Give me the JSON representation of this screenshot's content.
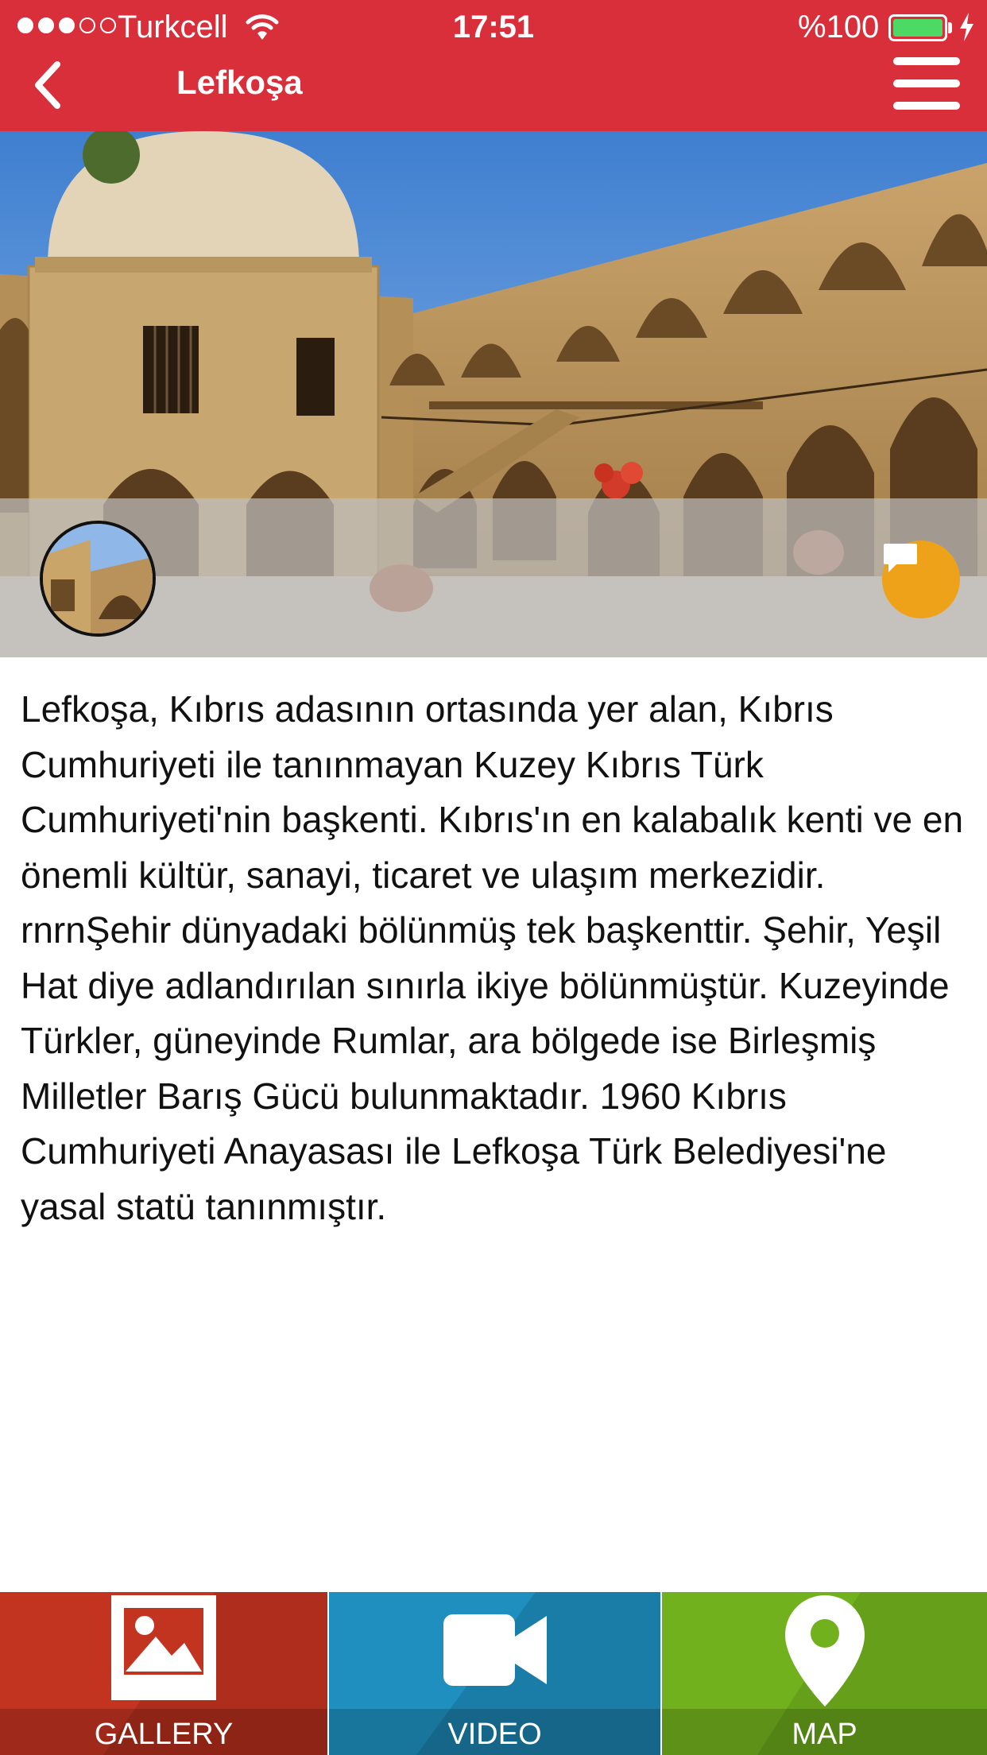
{
  "status_bar": {
    "carrier": "Turkcell",
    "time": "17:51",
    "battery_percent": "%100",
    "signal_bars_filled": 3,
    "signal_bars_total": 5
  },
  "nav": {
    "title": "Lefkoşa",
    "back_icon": "chevron-left-icon",
    "menu_icon": "hamburger-menu-icon"
  },
  "hero": {
    "comment_icon": "chat-bubble-icon"
  },
  "article": {
    "text": "Lefkoşa, Kıbrıs adasının ortasında yer alan, Kıbrıs Cumhuriyeti ile tanınmayan Kuzey Kıbrıs Türk Cumhuriyeti'nin başkenti. Kıbrıs'ın en kalabalık kenti ve en önemli kültür, sanayi, ticaret ve ulaşım merkezidir. rnrnŞehir dünyadaki bölünmüş tek başkenttir. Şehir, Yeşil Hat diye adlandırılan sınırla ikiye bölünmüştür. Kuzeyinde Türkler, güneyinde Rumlar, ara bölgede ise Birleşmiş Milletler Barış Gücü bulunmaktadır. 1960 Kıbrıs Cumhuriyeti Anayasası ile Lefkoşa Türk Belediyesi'ne yasal statü tanınmıştır."
  },
  "tabs": [
    {
      "label": "GALLERY",
      "icon": "image-icon",
      "color": "#c23320"
    },
    {
      "label": "VIDEO",
      "icon": "video-camera-icon",
      "color": "#1e8fbf"
    },
    {
      "label": "MAP",
      "icon": "map-pin-icon",
      "color": "#72b11e"
    }
  ],
  "colors": {
    "header": "#d82f3a",
    "comment_button": "#eea21a",
    "battery": "#4cd964"
  }
}
